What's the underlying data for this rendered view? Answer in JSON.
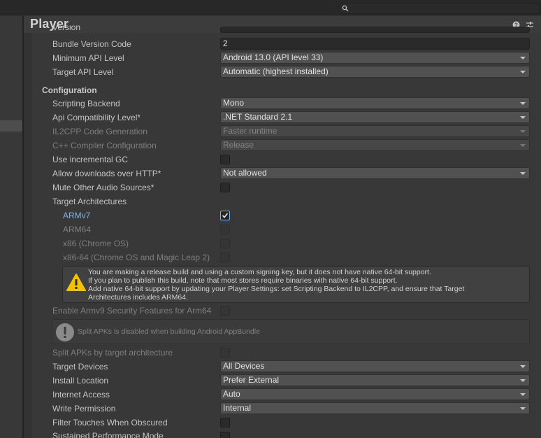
{
  "window": {
    "title": "Player"
  },
  "search": {
    "placeholder": ""
  },
  "rows": {
    "version_partial": {
      "label": "Version"
    },
    "bundle_version_code": {
      "label": "Bundle Version Code",
      "value": "2"
    },
    "min_api": {
      "label": "Minimum API Level",
      "value": "Android 13.0 (API level 33)"
    },
    "target_api": {
      "label": "Target API Level",
      "value": "Automatic (highest installed)"
    },
    "configuration": {
      "label": "Configuration"
    },
    "scripting_backend": {
      "label": "Scripting Backend",
      "value": "Mono"
    },
    "api_compat": {
      "label": "Api Compatibility Level*",
      "value": ".NET Standard 2.1"
    },
    "il2cpp_codegen": {
      "label": "IL2CPP Code Generation",
      "value": "Faster runtime"
    },
    "cpp_compiler": {
      "label": "C++ Compiler Configuration",
      "value": "Release"
    },
    "incremental_gc": {
      "label": "Use incremental GC",
      "checked": false
    },
    "http_downloads": {
      "label": "Allow downloads over HTTP*",
      "value": "Not allowed"
    },
    "mute_audio": {
      "label": "Mute Other Audio Sources*",
      "checked": false
    },
    "target_arch": {
      "label": "Target Architectures"
    },
    "armv7": {
      "label": "ARMv7",
      "checked": true
    },
    "arm64": {
      "label": "ARM64",
      "checked": false
    },
    "x86": {
      "label": "x86 (Chrome OS)",
      "checked": false
    },
    "x86_64": {
      "label": "x86-64 (Chrome OS and Magic Leap 2)",
      "checked": false
    },
    "armv9": {
      "label": "Enable Armv9 Security Features for Arm64",
      "checked": false
    },
    "split_apks": {
      "label": "Split APKs by target architecture",
      "checked": false
    },
    "target_devices": {
      "label": "Target Devices",
      "value": "All Devices"
    },
    "install_location": {
      "label": "Install Location",
      "value": "Prefer External"
    },
    "internet_access": {
      "label": "Internet Access",
      "value": "Auto"
    },
    "write_permission": {
      "label": "Write Permission",
      "value": "Internal"
    },
    "filter_touches": {
      "label": "Filter Touches When Obscured",
      "checked": false
    },
    "sustained_perf": {
      "label": "Sustained Performance Mode",
      "checked": false
    }
  },
  "warning": {
    "line1": "You are making a release build and using a custom signing key, but it does not have native 64-bit support.",
    "line2": "If you plan to publish this build, note that most stores require binaries with native 64-bit support.",
    "line3": "Add native 64-bit support by updating your Player Settings: set Scripting Backend to IL2CPP, and ensure that Target",
    "line4": "Architectures includes ARM64."
  },
  "info": {
    "text": "Split APKs is disabled when building Android AppBundle"
  },
  "icons": {
    "search": "search-icon",
    "help": "help-icon",
    "settings": "sliders-icon",
    "warning": "warning-icon",
    "info": "info-icon"
  },
  "colors": {
    "accent": "#7bb2ee",
    "warning": "#f2c200"
  }
}
